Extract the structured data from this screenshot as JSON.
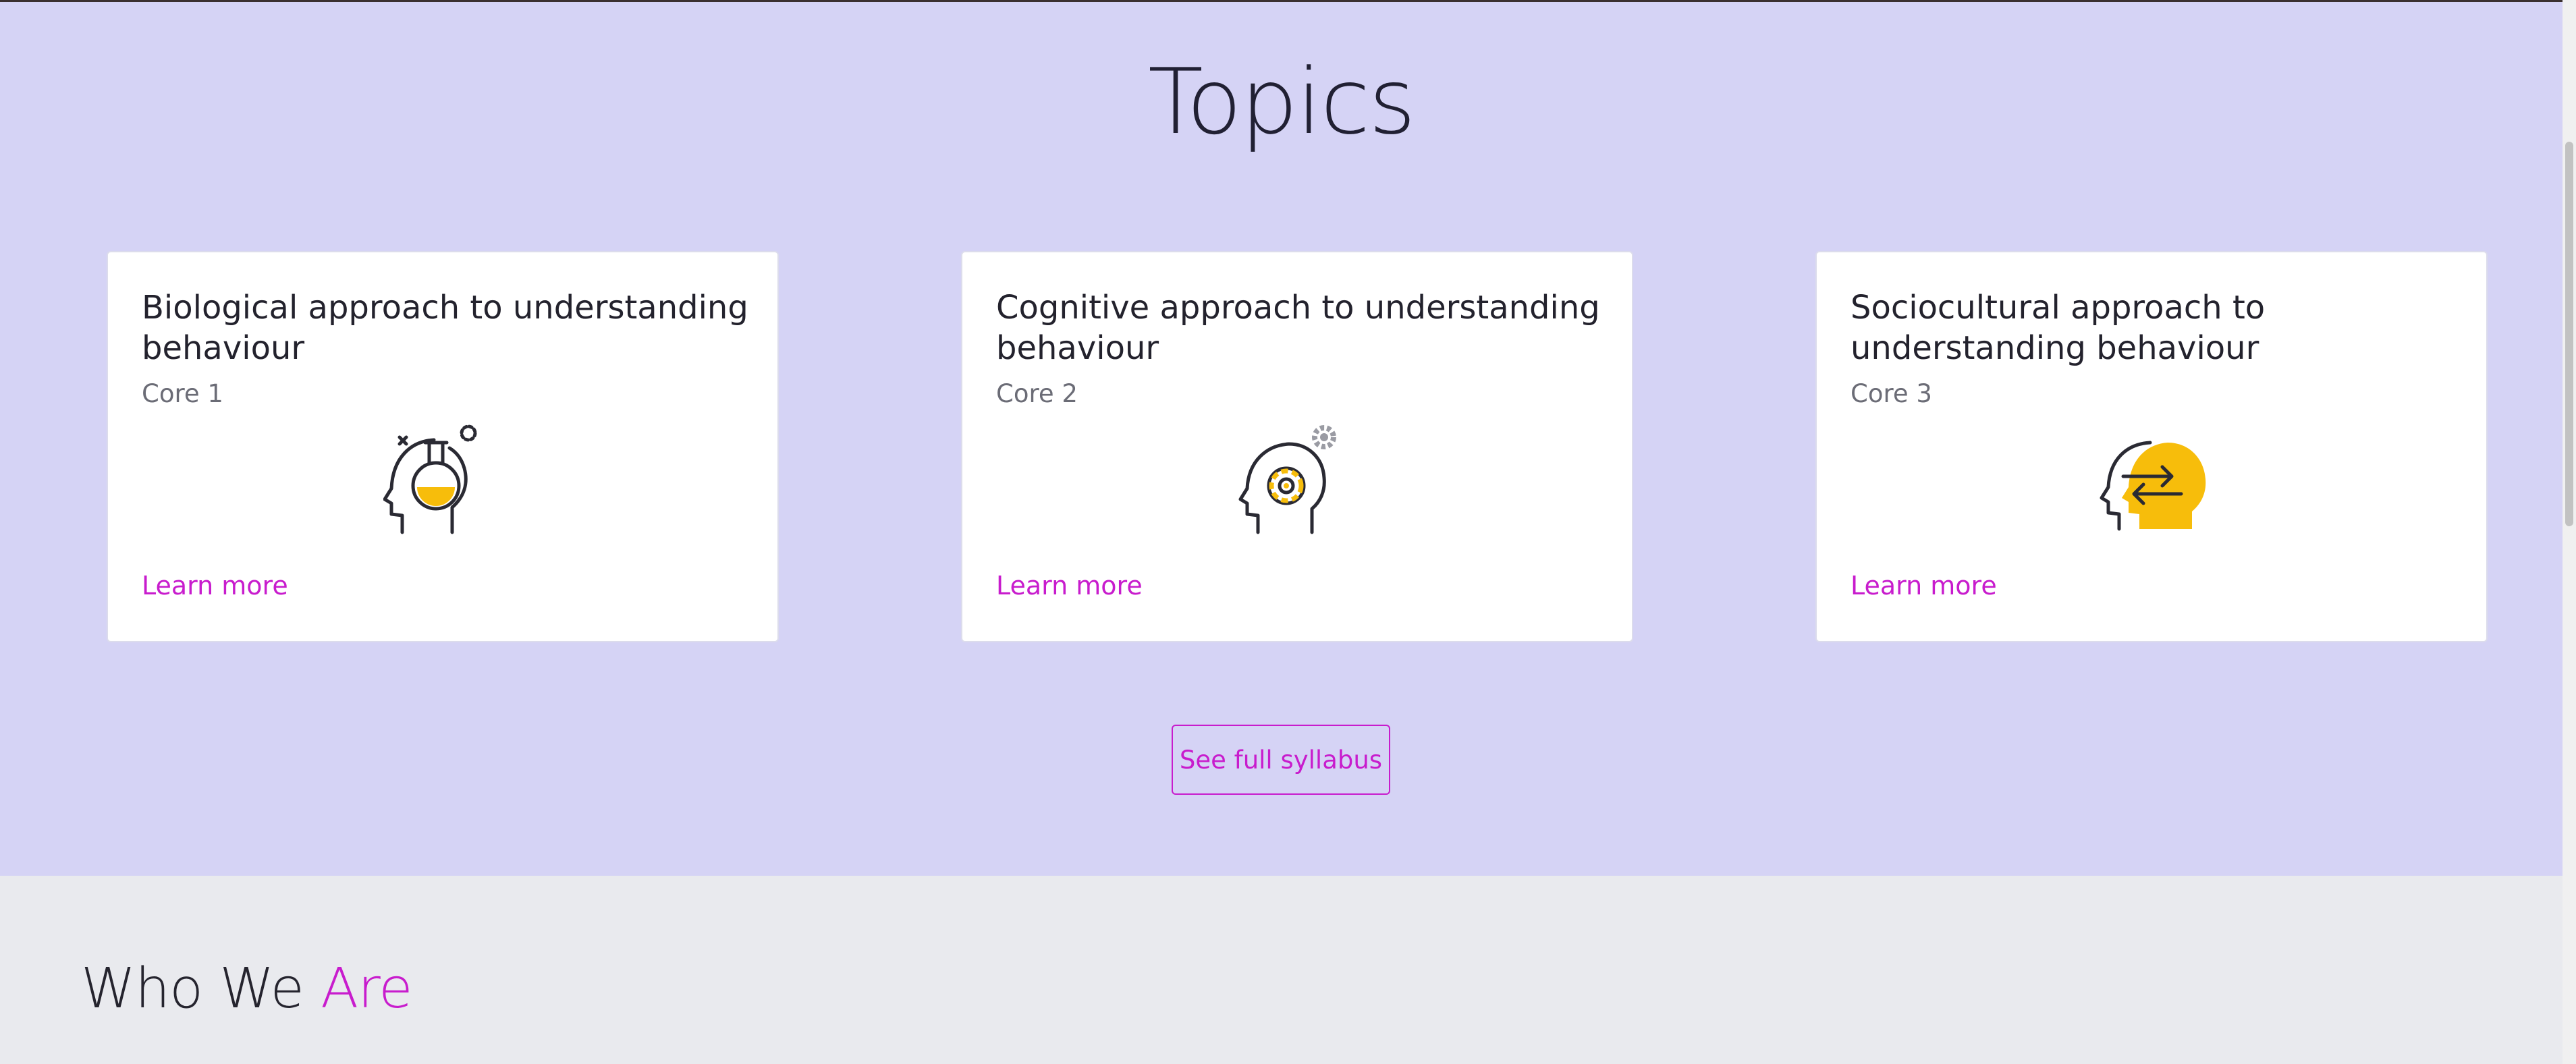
{
  "topics": {
    "title": "Topics",
    "cards": [
      {
        "title": "Biological approach to understanding behaviour",
        "subtitle": "Core 1",
        "icon": "head-flask-icon",
        "link": "Learn more"
      },
      {
        "title": "Cognitive approach to understanding behaviour",
        "subtitle": "Core 2",
        "icon": "head-gear-icon",
        "link": "Learn more"
      },
      {
        "title": "Sociocultural approach to understanding behaviour",
        "subtitle": "Core 3",
        "icon": "head-exchange-icon",
        "link": "Learn more"
      }
    ],
    "syllabus_button": "See full syllabus"
  },
  "who": {
    "title_main": "Who We ",
    "title_accent": "Are"
  },
  "colors": {
    "topics_bg": "#d5d3f5",
    "accent": "#c81ccd",
    "icon_yellow": "#f7bd0b",
    "lower_bg": "#e9eaee"
  }
}
